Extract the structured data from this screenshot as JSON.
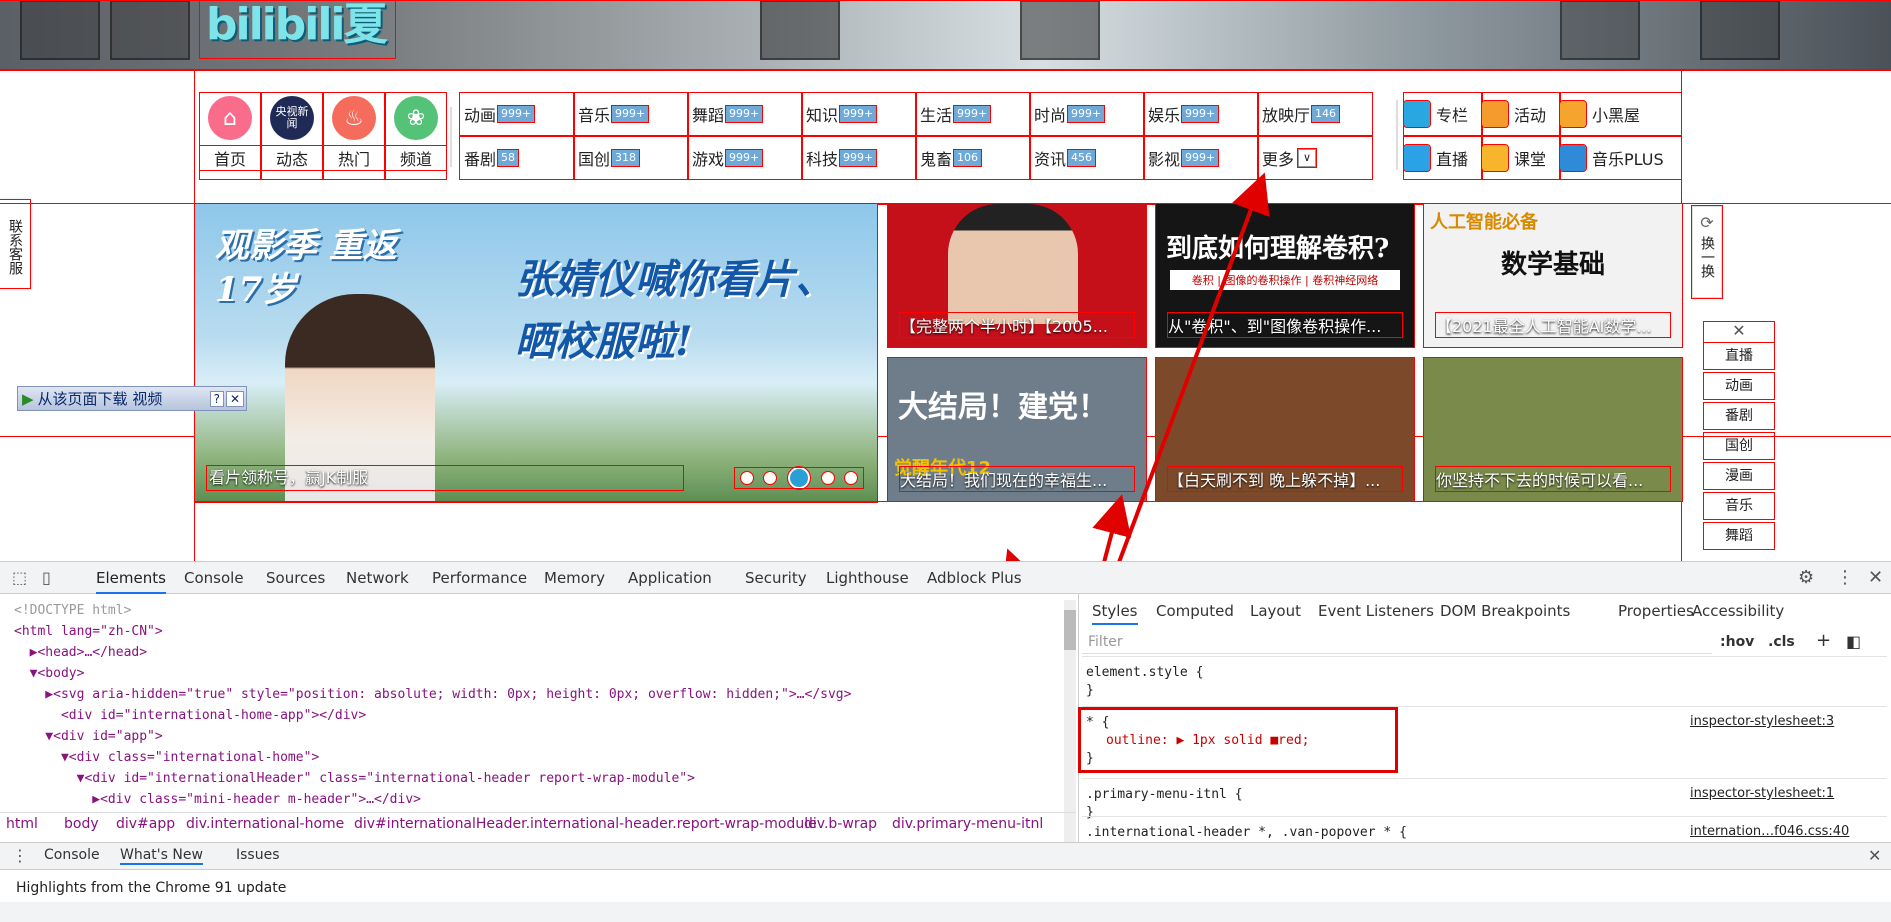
{
  "header": {
    "logo_text": "bilibili夏"
  },
  "nav": {
    "icons": [
      {
        "label": "首页",
        "icon": "home-icon",
        "color": "#fa6c8c"
      },
      {
        "label": "动态",
        "icon": "cctv-news-icon",
        "color": "#1f2a56"
      },
      {
        "label": "热门",
        "icon": "fire-icon",
        "color": "#f56c5d"
      },
      {
        "label": "频道",
        "icon": "channel-icon",
        "color": "#54c277"
      }
    ],
    "cctv_text": "央视新闻",
    "categories_row1": [
      {
        "name": "动画",
        "count": "999+"
      },
      {
        "name": "音乐",
        "count": "999+"
      },
      {
        "name": "舞蹈",
        "count": "999+"
      },
      {
        "name": "知识",
        "count": "999+"
      },
      {
        "name": "生活",
        "count": "999+"
      },
      {
        "name": "时尚",
        "count": "999+"
      },
      {
        "name": "娱乐",
        "count": "999+"
      },
      {
        "name": "放映厅",
        "count": "146"
      }
    ],
    "categories_row2": [
      {
        "name": "番剧",
        "count": "58"
      },
      {
        "name": "国创",
        "count": "318"
      },
      {
        "name": "游戏",
        "count": "999+"
      },
      {
        "name": "科技",
        "count": "999+"
      },
      {
        "name": "鬼畜",
        "count": "106"
      },
      {
        "name": "资讯",
        "count": "456"
      },
      {
        "name": "影视",
        "count": "999+"
      },
      {
        "name": "更多",
        "count": ""
      }
    ],
    "right_links": [
      {
        "label": "专栏",
        "color": "#29a7e1"
      },
      {
        "label": "活动",
        "color": "#f59b2d"
      },
      {
        "label": "小黑屋",
        "color": "#f5a52d"
      },
      {
        "label": "直播",
        "color": "#2ba2e6"
      },
      {
        "label": "课堂",
        "color": "#f7b52b"
      },
      {
        "label": "音乐PLUS",
        "color": "#2f8bd8"
      }
    ]
  },
  "left_float": {
    "contact": "联系客服",
    "download": "从该页面下载 视频",
    "help": "?",
    "close": "✕"
  },
  "hero": {
    "title_main": "张婧仪喊你看片、晒校服啦!",
    "title_tag": "观影季 重返17岁",
    "caption": "看片领称号，赢JK制服"
  },
  "thumbs": [
    {
      "caption": "【完整两个半小时】【2005...",
      "color": "#c5101a"
    },
    {
      "caption": "从\"卷积\"、到\"图像卷积操作...",
      "color": "#151515",
      "title": "到底如何理解卷积?",
      "sub": "卷积 | 图像的卷积操作 | 卷积神经网络"
    },
    {
      "caption": "【2021最全人工智能AI数学...",
      "color": "#f2f2f2",
      "title": "数学基础",
      "tag": "人工智能必备"
    },
    {
      "caption": "大结局！我们现在的幸福生...",
      "color": "#6f7d8a",
      "title": "大结局！建党！",
      "tag": "觉醒年代12"
    },
    {
      "caption": "【白天刷不到 晚上躲不掉】...",
      "color": "#7c4a2b"
    },
    {
      "caption": "你坚持不下去的时候可以看...",
      "color": "#7a8a4a"
    }
  ],
  "refresh": {
    "label": "换一换"
  },
  "side_nav": [
    "直播",
    "动画",
    "番剧",
    "国创",
    "漫画",
    "音乐",
    "舞蹈"
  ],
  "devtools": {
    "tabs": [
      "Elements",
      "Console",
      "Sources",
      "Network",
      "Performance",
      "Memory",
      "Application",
      "Security",
      "Lighthouse",
      "Adblock Plus"
    ],
    "style_tabs": [
      "Styles",
      "Computed",
      "Layout",
      "Event Listeners",
      "DOM Breakpoints",
      "Properties",
      "Accessibility"
    ],
    "filter_placeholder": "Filter",
    "hov": ":hov",
    "cls": ".cls",
    "dom_lines": [
      "<!DOCTYPE html>",
      "<html lang=\"zh-CN\">",
      "  ▶<head>…</head>",
      "  ▼<body>",
      "    ▶<svg aria-hidden=\"true\" style=\"position: absolute; width: 0px; height: 0px; overflow: hidden;\">…</svg>",
      "      <div id=\"international-home-app\"></div>",
      "    ▼<div id=\"app\">",
      "      ▼<div class=\"international-home\">",
      "        ▼<div id=\"internationalHeader\" class=\"international-header report-wrap-module\">",
      "          ▶<div class=\"mini-header m-header\">…</div>"
    ],
    "breadcrumbs": [
      "html",
      "body",
      "div#app",
      "div.international-home",
      "div#internationalHeader.international-header.report-wrap-module",
      "div.b-wrap",
      "div.primary-menu-itnl"
    ],
    "rules": [
      {
        "selector": "element.style {",
        "body": "",
        "close": "}",
        "source": ""
      },
      {
        "selector": "* {",
        "body": "outline: ▶ 1px solid ■red;",
        "close": "}",
        "source": "inspector-stylesheet:3"
      },
      {
        "selector": ".primary-menu-itnl {",
        "body": "",
        "close": "}",
        "source": "inspector-stylesheet:1"
      },
      {
        "selector": ".international-header *, .van-popover * {",
        "body": "",
        "close": "",
        "source": "internation…f046.css:40"
      }
    ],
    "drawer_tabs": [
      "Console",
      "What's New",
      "Issues"
    ],
    "drawer_text": "Highlights from the Chrome 91 update"
  },
  "colors": {
    "outline": "#ff0000",
    "count_badge": "#6ea9d8",
    "devtools_accent": "#1a73e8"
  }
}
